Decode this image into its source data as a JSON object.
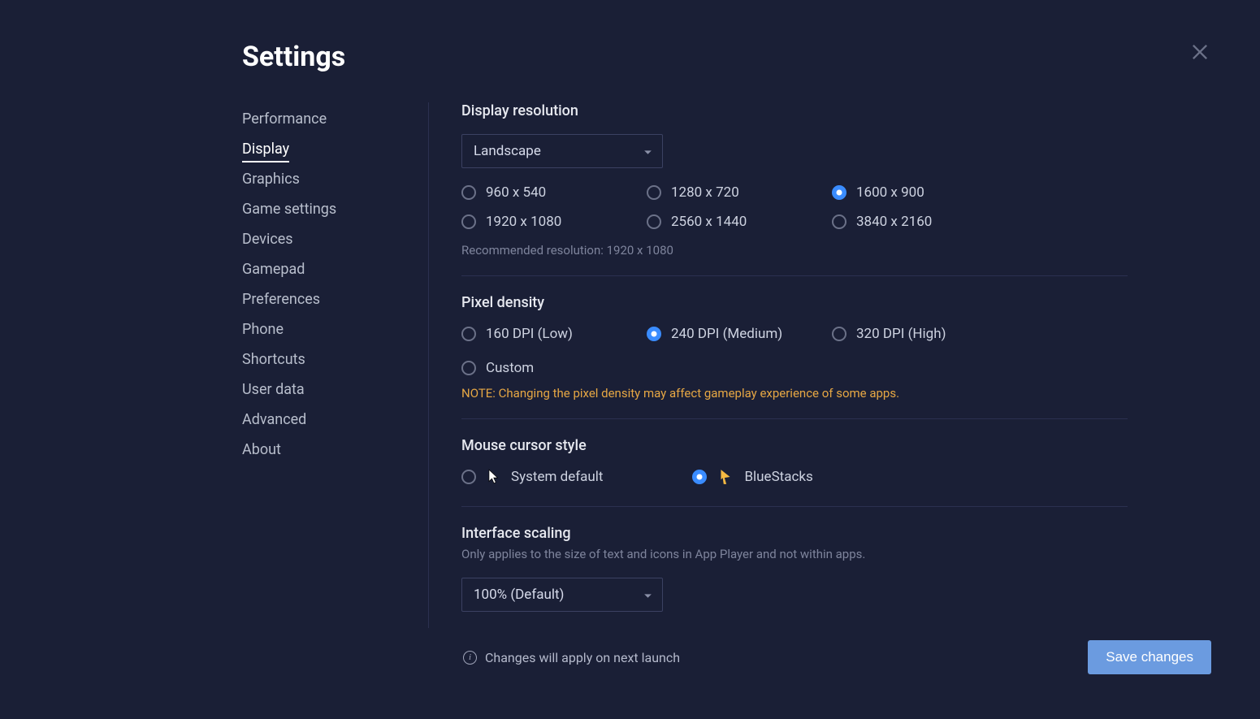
{
  "title": "Settings",
  "sidebar": {
    "items": [
      {
        "label": "Performance"
      },
      {
        "label": "Display",
        "active": true
      },
      {
        "label": "Graphics"
      },
      {
        "label": "Game settings"
      },
      {
        "label": "Devices"
      },
      {
        "label": "Gamepad"
      },
      {
        "label": "Preferences"
      },
      {
        "label": "Phone"
      },
      {
        "label": "Shortcuts"
      },
      {
        "label": "User data"
      },
      {
        "label": "Advanced"
      },
      {
        "label": "About"
      }
    ]
  },
  "display": {
    "resolution": {
      "title": "Display resolution",
      "orientation": "Landscape",
      "options": [
        {
          "label": "960 x 540",
          "selected": false
        },
        {
          "label": "1280 x 720",
          "selected": false
        },
        {
          "label": "1600 x 900",
          "selected": true
        },
        {
          "label": "1920 x 1080",
          "selected": false
        },
        {
          "label": "2560 x 1440",
          "selected": false
        },
        {
          "label": "3840 x 2160",
          "selected": false
        }
      ],
      "recommended": "Recommended resolution: 1920 x 1080"
    },
    "density": {
      "title": "Pixel density",
      "options": [
        {
          "label": "160 DPI (Low)",
          "selected": false
        },
        {
          "label": "240 DPI (Medium)",
          "selected": true
        },
        {
          "label": "320 DPI (High)",
          "selected": false
        },
        {
          "label": "Custom",
          "selected": false
        }
      ],
      "note": "NOTE: Changing the pixel density may affect gameplay experience of some apps."
    },
    "cursor": {
      "title": "Mouse cursor style",
      "options": [
        {
          "label": "System default",
          "selected": false
        },
        {
          "label": "BlueStacks",
          "selected": true
        }
      ]
    },
    "scaling": {
      "title": "Interface scaling",
      "sub": "Only applies to the size of text and icons in App Player and not within apps.",
      "value": "100% (Default)"
    }
  },
  "footer": {
    "info": "Changes will apply on next launch",
    "save": "Save changes"
  }
}
